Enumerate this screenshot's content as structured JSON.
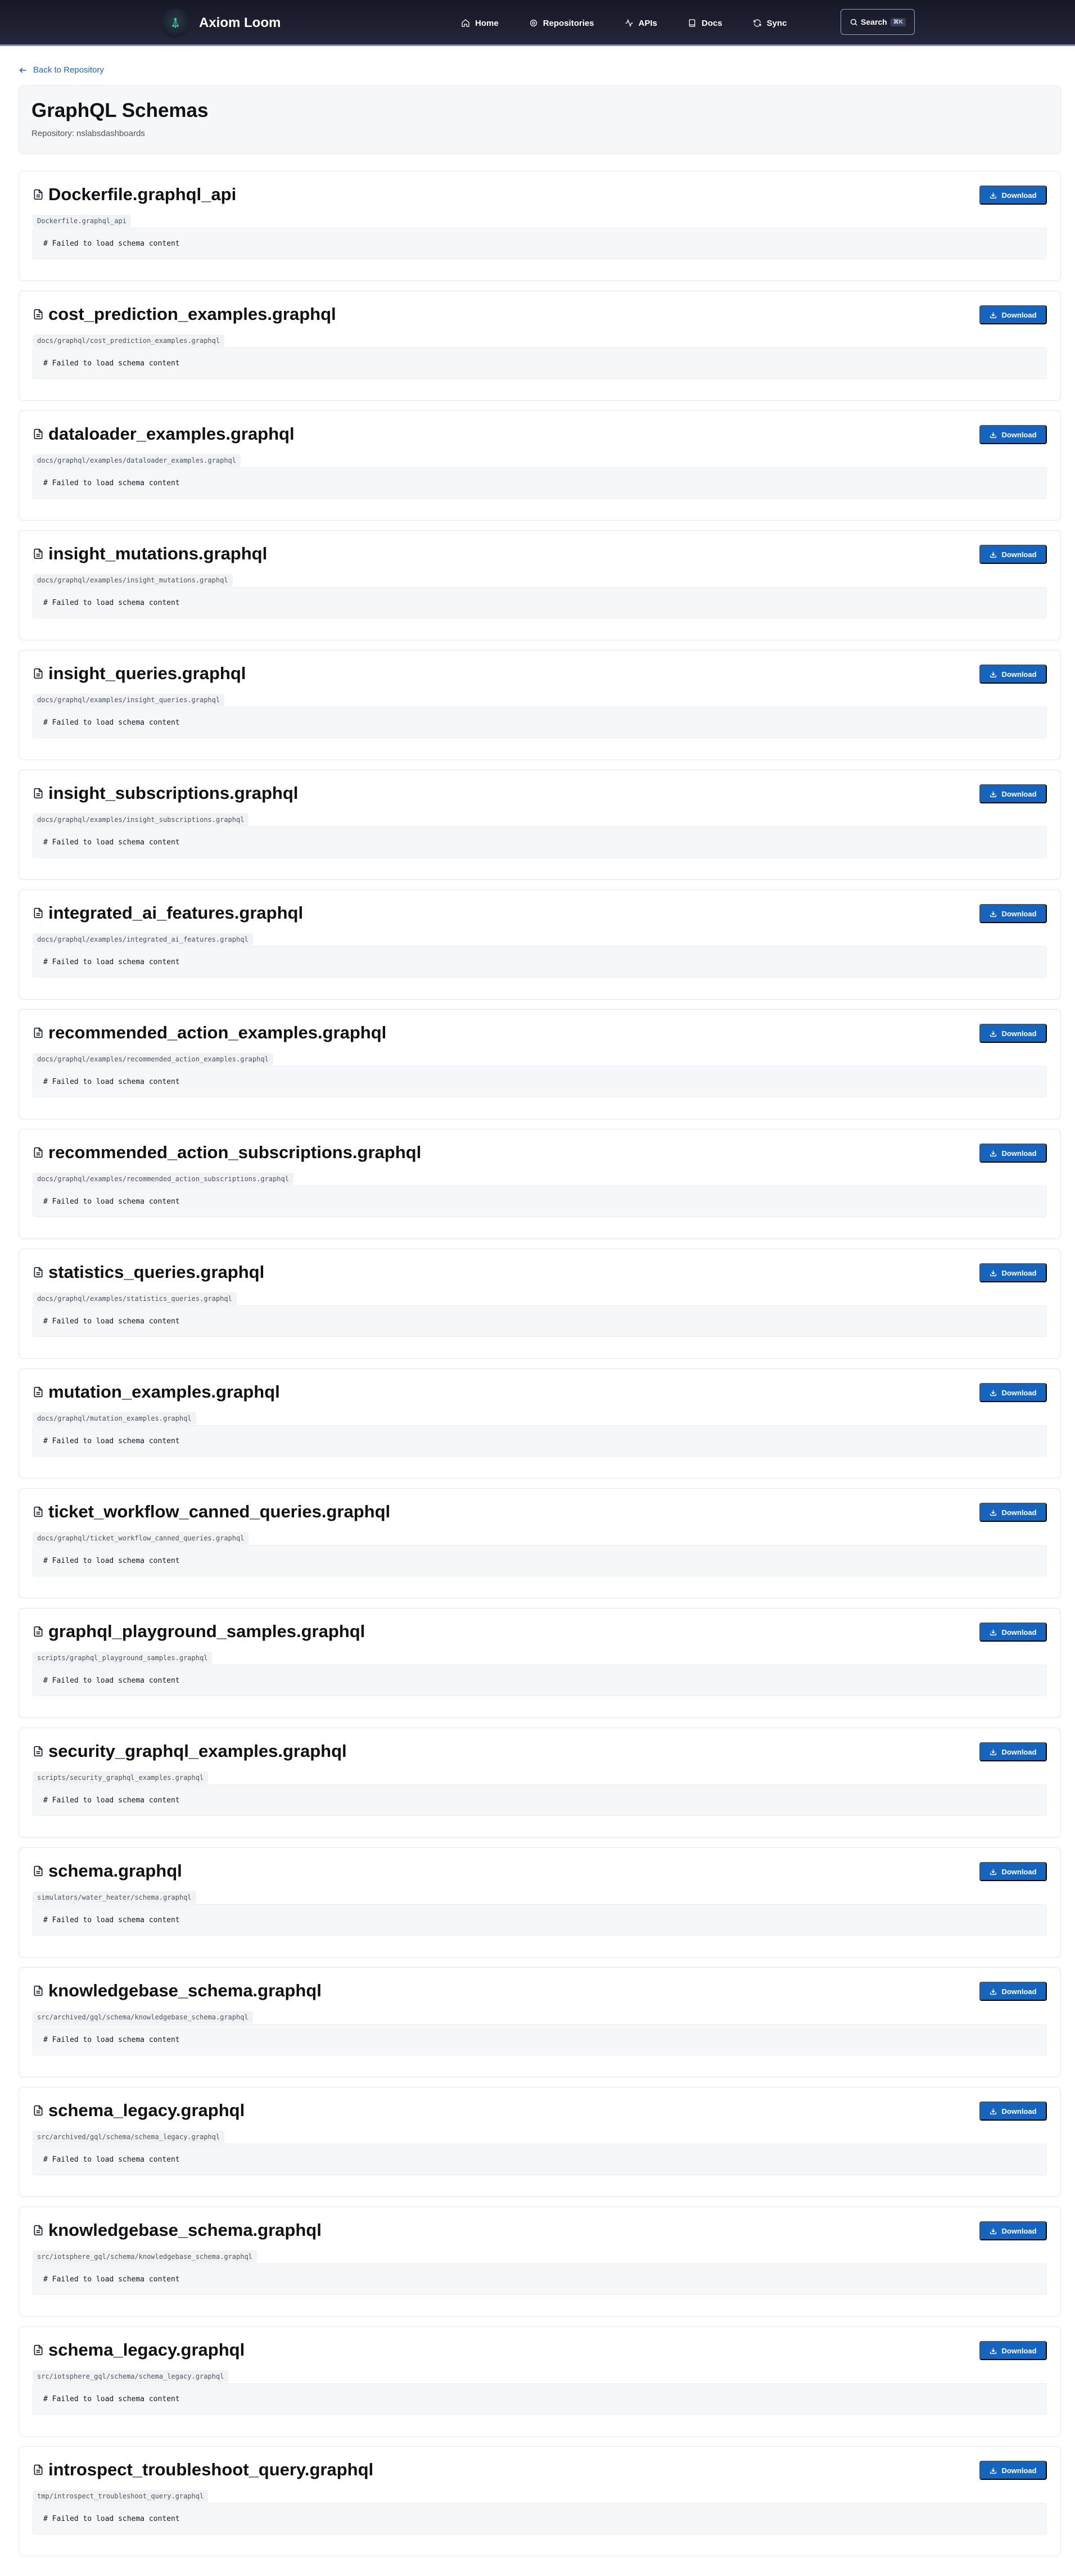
{
  "header": {
    "app_name": "Axiom Loom",
    "logo_icon": "neural-network-logo-icon",
    "nav": [
      {
        "label": "Home",
        "icon": "home-icon"
      },
      {
        "label": "Repositories",
        "icon": "gear-icon"
      },
      {
        "label": "APIs",
        "icon": "activity-icon"
      },
      {
        "label": "Docs",
        "icon": "book-icon"
      },
      {
        "label": "Sync",
        "icon": "refresh-icon"
      }
    ],
    "search": {
      "label": "Search",
      "shortcut": "⌘K",
      "icon": "search-icon"
    },
    "colors": {
      "bar": "#1b1d2d",
      "accent_line": "#8b7fd9"
    }
  },
  "back_link": {
    "label": "Back to Repository",
    "icon": "arrow-left-icon"
  },
  "page": {
    "title": "GraphQL Schemas",
    "repository_line": "Repository: nslabsdashboards"
  },
  "download_label": "Download",
  "colors": {
    "primary": "#1565c0",
    "link": "#1e63c7"
  },
  "schemas": [
    {
      "name": "Dockerfile.graphql_api",
      "path": "Dockerfile.graphql_api",
      "content": "# Failed to load schema content"
    },
    {
      "name": "cost_prediction_examples.graphql",
      "path": "docs/graphql/cost_prediction_examples.graphql",
      "content": "# Failed to load schema content"
    },
    {
      "name": "dataloader_examples.graphql",
      "path": "docs/graphql/examples/dataloader_examples.graphql",
      "content": "# Failed to load schema content"
    },
    {
      "name": "insight_mutations.graphql",
      "path": "docs/graphql/examples/insight_mutations.graphql",
      "content": "# Failed to load schema content"
    },
    {
      "name": "insight_queries.graphql",
      "path": "docs/graphql/examples/insight_queries.graphql",
      "content": "# Failed to load schema content"
    },
    {
      "name": "insight_subscriptions.graphql",
      "path": "docs/graphql/examples/insight_subscriptions.graphql",
      "content": "# Failed to load schema content"
    },
    {
      "name": "integrated_ai_features.graphql",
      "path": "docs/graphql/examples/integrated_ai_features.graphql",
      "content": "# Failed to load schema content"
    },
    {
      "name": "recommended_action_examples.graphql",
      "path": "docs/graphql/examples/recommended_action_examples.graphql",
      "content": "# Failed to load schema content"
    },
    {
      "name": "recommended_action_subscriptions.graphql",
      "path": "docs/graphql/examples/recommended_action_subscriptions.graphql",
      "content": "# Failed to load schema content"
    },
    {
      "name": "statistics_queries.graphql",
      "path": "docs/graphql/examples/statistics_queries.graphql",
      "content": "# Failed to load schema content"
    },
    {
      "name": "mutation_examples.graphql",
      "path": "docs/graphql/mutation_examples.graphql",
      "content": "# Failed to load schema content"
    },
    {
      "name": "ticket_workflow_canned_queries.graphql",
      "path": "docs/graphql/ticket_workflow_canned_queries.graphql",
      "content": "# Failed to load schema content"
    },
    {
      "name": "graphql_playground_samples.graphql",
      "path": "scripts/graphql_playground_samples.graphql",
      "content": "# Failed to load schema content"
    },
    {
      "name": "security_graphql_examples.graphql",
      "path": "scripts/security_graphql_examples.graphql",
      "content": "# Failed to load schema content"
    },
    {
      "name": "schema.graphql",
      "path": "simulators/water_heater/schema.graphql",
      "content": "# Failed to load schema content"
    },
    {
      "name": "knowledgebase_schema.graphql",
      "path": "src/archived/gql/schema/knowledgebase_schema.graphql",
      "content": "# Failed to load schema content"
    },
    {
      "name": "schema_legacy.graphql",
      "path": "src/archived/gql/schema/schema_legacy.graphql",
      "content": "# Failed to load schema content"
    },
    {
      "name": "knowledgebase_schema.graphql",
      "path": "src/iotsphere_gql/schema/knowledgebase_schema.graphql",
      "content": "# Failed to load schema content"
    },
    {
      "name": "schema_legacy.graphql",
      "path": "src/iotsphere_gql/schema/schema_legacy.graphql",
      "content": "# Failed to load schema content"
    },
    {
      "name": "introspect_troubleshoot_query.graphql",
      "path": "tmp/introspect_troubleshoot_query.graphql",
      "content": "# Failed to load schema content"
    }
  ]
}
